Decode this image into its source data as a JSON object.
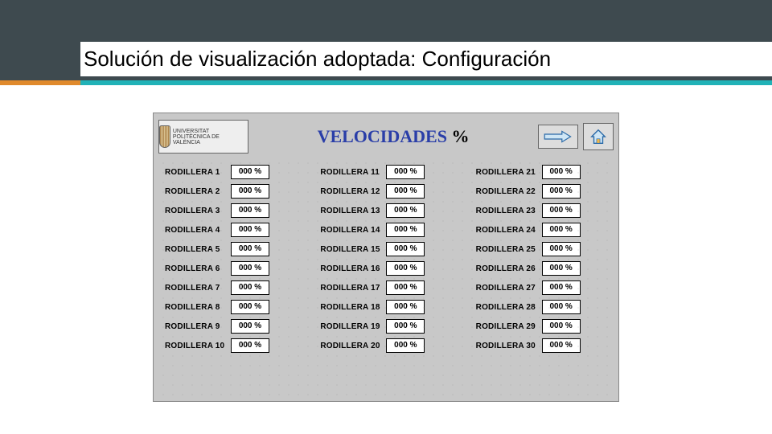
{
  "slide": {
    "title": "Solución de visualización adoptada: Configuración"
  },
  "hmi": {
    "logo_text": "UNIVERSITAT POLITÈCNICA DE VALÈNCIA",
    "title_main": "VELOCIDADES",
    "title_suffix": "%",
    "columns": [
      [
        {
          "label": "RODILLERA 1",
          "value": "000 %"
        },
        {
          "label": "RODILLERA 2",
          "value": "000 %"
        },
        {
          "label": "RODILLERA 3",
          "value": "000 %"
        },
        {
          "label": "RODILLERA 4",
          "value": "000 %"
        },
        {
          "label": "RODILLERA 5",
          "value": "000 %"
        },
        {
          "label": "RODILLERA 6",
          "value": "000 %"
        },
        {
          "label": "RODILLERA 7",
          "value": "000 %"
        },
        {
          "label": "RODILLERA 8",
          "value": "000 %"
        },
        {
          "label": "RODILLERA 9",
          "value": "000 %"
        },
        {
          "label": "RODILLERA 10",
          "value": "000 %"
        }
      ],
      [
        {
          "label": "RODILLERA 11",
          "value": "000 %"
        },
        {
          "label": "RODILLERA 12",
          "value": "000 %"
        },
        {
          "label": "RODILLERA 13",
          "value": "000 %"
        },
        {
          "label": "RODILLERA 14",
          "value": "000 %"
        },
        {
          "label": "RODILLERA 15",
          "value": "000 %"
        },
        {
          "label": "RODILLERA 16",
          "value": "000 %"
        },
        {
          "label": "RODILLERA 17",
          "value": "000 %"
        },
        {
          "label": "RODILLERA 18",
          "value": "000 %"
        },
        {
          "label": "RODILLERA 19",
          "value": "000 %"
        },
        {
          "label": "RODILLERA 20",
          "value": "000 %"
        }
      ],
      [
        {
          "label": "RODILLERA 21",
          "value": "000 %"
        },
        {
          "label": "RODILLERA 22",
          "value": "000 %"
        },
        {
          "label": "RODILLERA 23",
          "value": "000 %"
        },
        {
          "label": "RODILLERA 24",
          "value": "000 %"
        },
        {
          "label": "RODILLERA 25",
          "value": "000 %"
        },
        {
          "label": "RODILLERA 26",
          "value": "000 %"
        },
        {
          "label": "RODILLERA 27",
          "value": "000 %"
        },
        {
          "label": "RODILLERA 28",
          "value": "000 %"
        },
        {
          "label": "RODILLERA 29",
          "value": "000 %"
        },
        {
          "label": "RODILLERA 30",
          "value": "000 %"
        }
      ]
    ]
  }
}
